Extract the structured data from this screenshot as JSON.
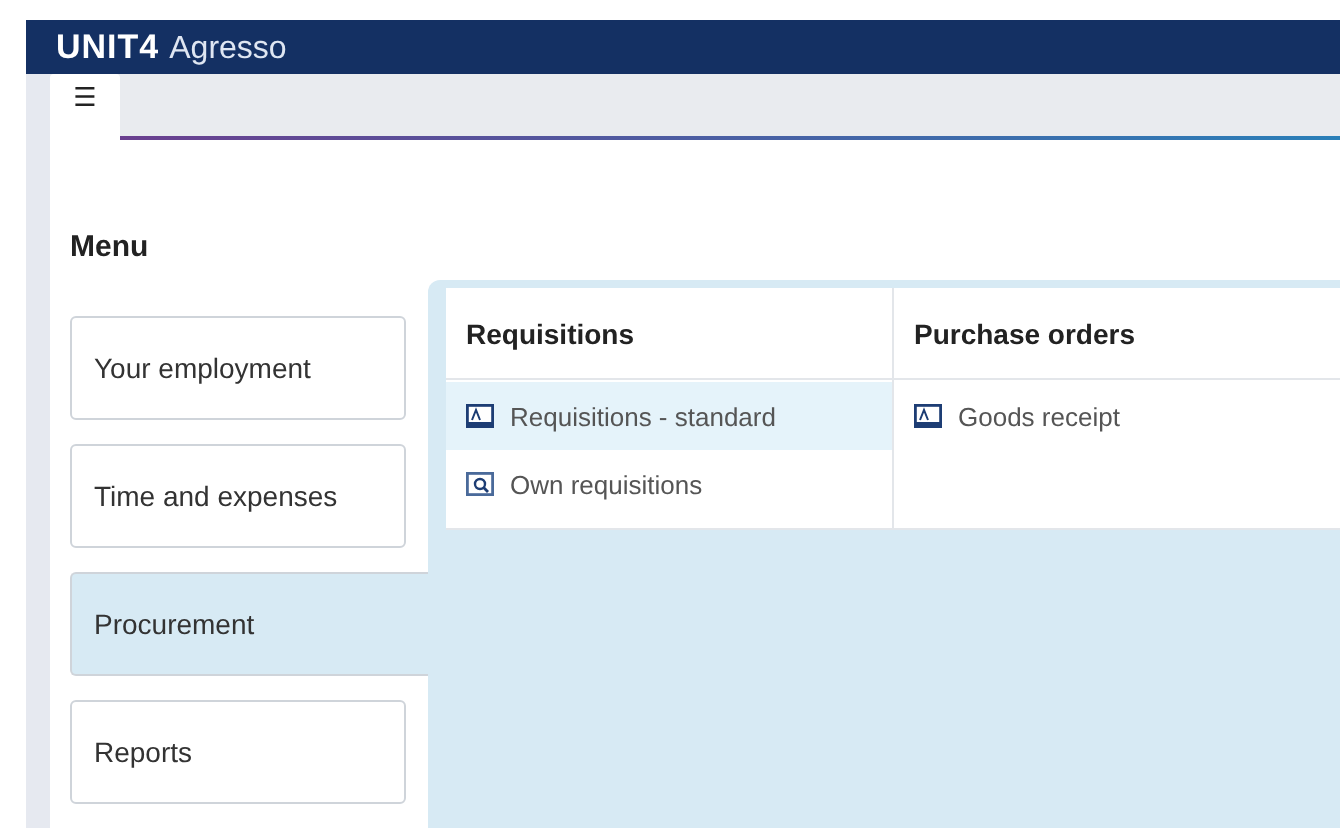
{
  "header": {
    "logo": "UNIT4",
    "product": "Agresso"
  },
  "tabs": [
    {
      "icon": "☰",
      "selected": true
    }
  ],
  "menu": {
    "title": "Menu",
    "items": [
      {
        "label": "Your employment",
        "selected": false
      },
      {
        "label": "Time and expenses",
        "selected": false
      },
      {
        "label": "Procurement",
        "selected": true
      },
      {
        "label": "Reports",
        "selected": false
      }
    ]
  },
  "columns": [
    {
      "title": "Requisitions",
      "items": [
        {
          "label": "Requisitions - standard",
          "kind": "form",
          "selected": true
        },
        {
          "label": "Own requisitions",
          "kind": "search",
          "selected": false
        }
      ]
    },
    {
      "title": "Purchase orders",
      "items": [
        {
          "label": "Goods receipt",
          "kind": "form",
          "selected": false
        }
      ]
    }
  ]
}
